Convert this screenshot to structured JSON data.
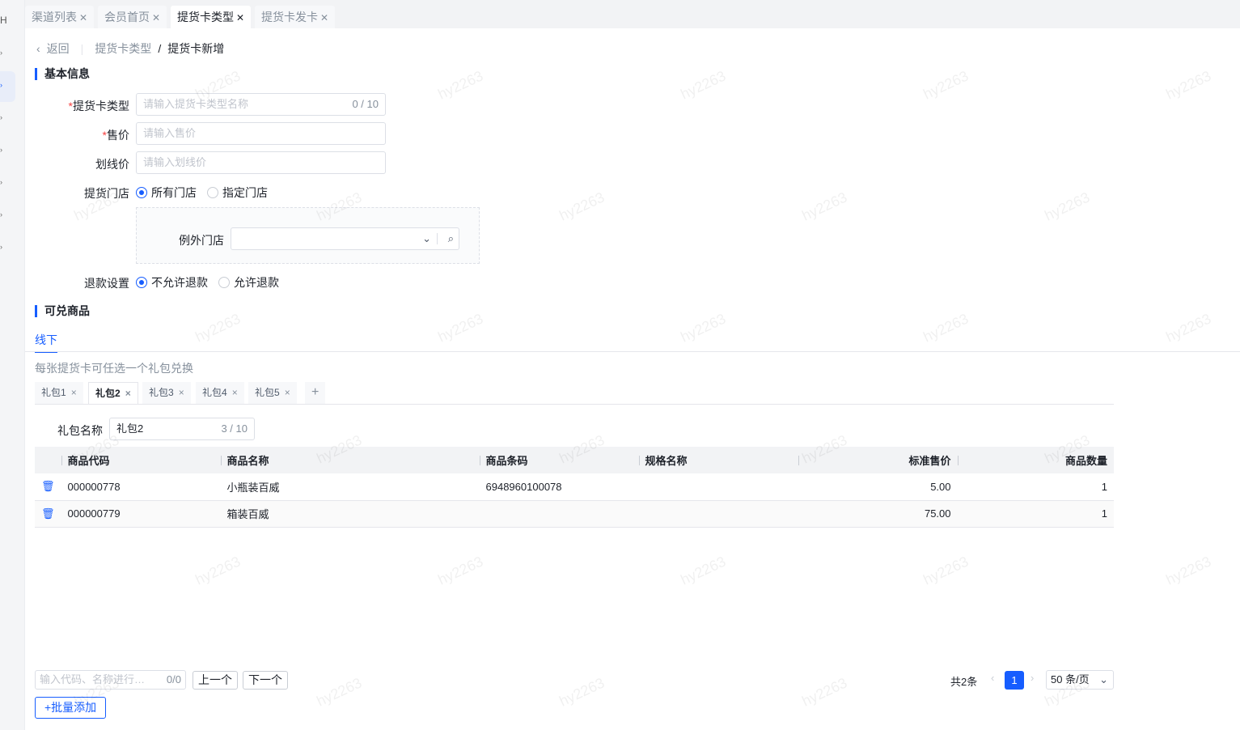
{
  "watermark": "hy2263",
  "tabs": [
    {
      "label": "渠道列表"
    },
    {
      "label": "会员首页"
    },
    {
      "label": "提货卡类型",
      "active": true
    },
    {
      "label": "提货卡发卡"
    }
  ],
  "breadcrumb": {
    "back": "返回",
    "parent": "提货卡类型",
    "current": "提货卡新增"
  },
  "basic": {
    "title": "基本信息",
    "type_label": "提货卡类型",
    "type_placeholder": "请输入提货卡类型名称",
    "type_count": "0 / 10",
    "price_label": "售价",
    "price_placeholder": "请输入售价",
    "line_label": "划线价",
    "line_placeholder": "请输入划线价",
    "store_label": "提货门店",
    "store_all": "所有门店",
    "store_specific": "指定门店",
    "except_label": "例外门店",
    "refund_label": "退款设置",
    "refund_no": "不允许退款",
    "refund_yes": "允许退款"
  },
  "goods": {
    "title": "可兑商品",
    "tab": "线下",
    "hint": "每张提货卡可任选一个礼包兑换",
    "packs": [
      "礼包1",
      "礼包2",
      "礼包3",
      "礼包4",
      "礼包5"
    ],
    "add": "+",
    "pack_name_label": "礼包名称",
    "pack_name": "礼包2",
    "pack_count": "3 / 10",
    "columns": [
      "商品代码",
      "商品名称",
      "商品条码",
      "规格名称",
      "标准售价",
      "商品数量"
    ],
    "rows": [
      {
        "code": "000000778",
        "name": "小瓶装百威",
        "barcode": "6948960100078",
        "spec": "",
        "price": "5.00",
        "qty": "1"
      },
      {
        "code": "000000779",
        "name": "箱装百威",
        "barcode": "",
        "spec": "",
        "price": "75.00",
        "qty": "1"
      }
    ]
  },
  "footer": {
    "search_placeholder": "输入代码、名称进行…",
    "search_count": "0/0",
    "prev": "上一个",
    "next": "下一个",
    "batch_add": "+批量添加",
    "total": "共2条",
    "page": "1",
    "page_size": "50 条/页"
  }
}
